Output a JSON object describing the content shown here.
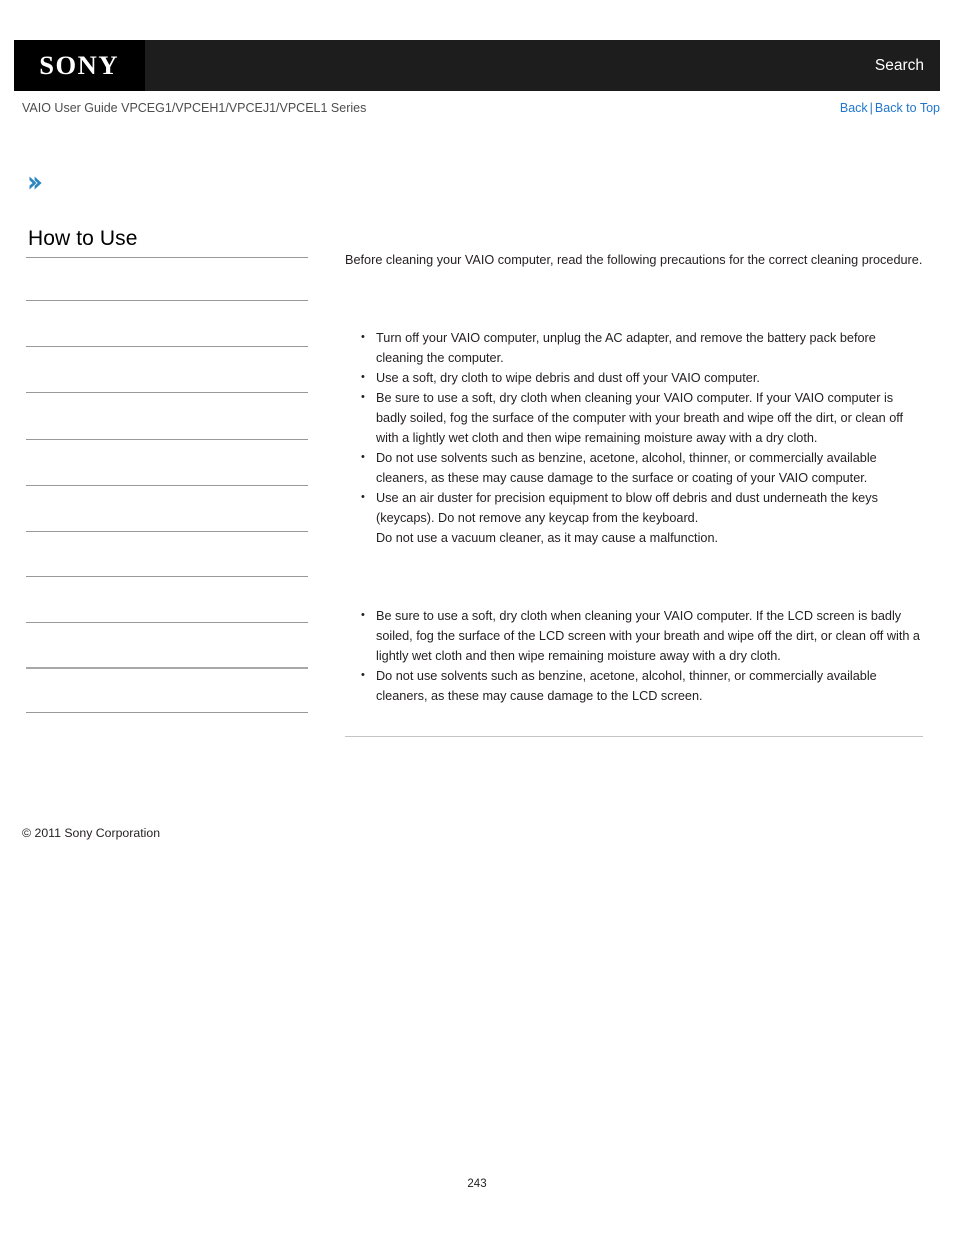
{
  "header": {
    "logo_text": "SONY",
    "search_label": "Search",
    "background_color": "#1d1d1d",
    "logo_background_color": "#000000"
  },
  "breadcrumb": {
    "guide_title": "VAIO User Guide VPCEG1/VPCEH1/VPCEJ1/VPCEL1 Series",
    "back_label": "Back",
    "separator": "|",
    "back_to_top_label": "Back to Top",
    "link_color": "#2277cc"
  },
  "icons": {
    "expand_chevron": "chevron-right-icon",
    "chevron_color": "#2e86c1"
  },
  "sidebar": {
    "heading": "How to Use",
    "items": [
      {
        "label": ""
      },
      {
        "label": ""
      },
      {
        "label": ""
      },
      {
        "label": ""
      },
      {
        "label": ""
      },
      {
        "label": ""
      },
      {
        "label": ""
      },
      {
        "label": ""
      },
      {
        "label": ""
      },
      {
        "label": ""
      }
    ]
  },
  "main": {
    "intro": "Before cleaning your VAIO computer, read the following precautions for the correct cleaning procedure.",
    "computer_section": {
      "heading": "",
      "bullets": [
        "Turn off your VAIO computer, unplug the AC adapter, and remove the battery pack before cleaning the computer.",
        "Use a soft, dry cloth to wipe debris and dust off your VAIO computer.",
        "Be sure to use a soft, dry cloth when cleaning your VAIO computer. If your VAIO computer is badly soiled, fog the surface of the computer with your breath and wipe off the dirt, or clean off with a lightly wet cloth and then wipe remaining moisture away with a dry cloth.",
        "Do not use solvents such as benzine, acetone, alcohol, thinner, or commercially available cleaners, as these may cause damage to the surface or coating of your VAIO computer.",
        "Use an air duster for precision equipment to blow off debris and dust underneath the keys (keycaps). Do not remove any keycap from the keyboard.\nDo not use a vacuum cleaner, as it may cause a malfunction."
      ]
    },
    "lcd_section": {
      "heading": "",
      "bullets": [
        "Be sure to use a soft, dry cloth when cleaning your VAIO computer. If the LCD screen is badly soiled, fog the surface of the LCD screen with your breath and wipe off the dirt, or clean off with a lightly wet cloth and then wipe remaining moisture away with a dry cloth.",
        "Do not use solvents such as benzine, acetone, alcohol, thinner, or commercially available cleaners, as these may cause damage to the LCD screen."
      ]
    }
  },
  "footer": {
    "copyright": "© 2011 Sony Corporation",
    "page_number": "243"
  }
}
